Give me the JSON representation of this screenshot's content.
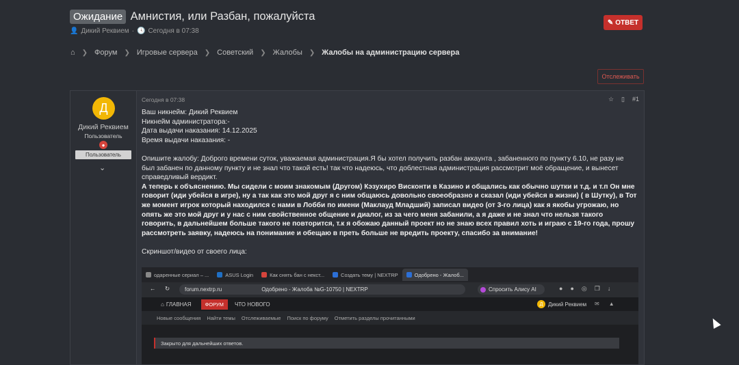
{
  "header": {
    "status": "Ожидание",
    "title": "Амнистия, или Разбан, пожалуйста",
    "author": "Дикий Реквием",
    "date": "Сегодня в 07:38",
    "reply": "ОТВЕТ"
  },
  "breadcrumbs": [
    "Форум",
    "Игровые сервера",
    "Советский",
    "Жалобы",
    "Жалобы на администрацию сервера"
  ],
  "watch": "Отслеживать",
  "post": {
    "user": {
      "avatar_letter": "Д",
      "name": "Дикий Реквием",
      "role": "Пользователь",
      "role_banner": "Пользователь"
    },
    "time": "Сегодня в 07:38",
    "number": "#1",
    "lines": [
      "Ваш никнейм: Дикий Реквием",
      "Никнейм администратора:-",
      "Дата выдачи наказания: 14.12.2025",
      "Время выдачи наказания: -",
      "Опишите жалобу: Доброго времени суток, уважаемая администрация.Я бы хотел получить разбан аккаунта , забаненного по пункту 6.10, не разу не был забанен по данному пункту и не знал что такой есть! так что надеюсь, что доблестная администрация рассмотрит моё обращение, и вынесет справедливый вердикт.",
      "А теперь к объяснению. Мы сидели с моим знакомым (Другом) Кэзухиро Висконти в Казино и общались как обычно шутки и т.д. и т.п Он мне говорит (иди убейся в игре), ну а так как это мой друг я с ним общаюсь довольно своеобразно и сказал (иди убейся в жизни) ( в Шутку), в Тот же момент игрок который находился с нами в Лобби по имени (Маклауд Младший) записал видео (от 3-го лица) как я якобы угрожаю, но опять же это мой друг и у нас с ним свойственное общение и диалог, из за чего меня забанили, а я даже и не знал что нельзя такого говорить, в дальнейшем больше такого не повторится, т.к я обожаю данный проект но не знаю всех правил хоть и играю с 19-го года, прошу рассмотреть заявку, надеюсь на понимание и обещаю в преть больше не вредить проекту, спасибо за внимание!",
      "Скриншот/видео от своего лица:"
    ]
  },
  "screenshot": {
    "tabs": [
      "одаренные сериал – ...",
      "ASUS Login",
      "Как снять бан с некст...",
      "Создать тему | NEXTRP",
      "Одобрено - Жалоб..."
    ],
    "url": "forum.nextrp.ru",
    "page_title": "Одобрено - Жалоба №G-10750 | NEXTRP",
    "alice": "Спросить Алису AI",
    "nav": {
      "home": "ГЛАВНАЯ",
      "forum": "ФОРУМ",
      "whats_new": "ЧТО НОВОГО",
      "user": "Дикий Реквием"
    },
    "subnav": [
      "Новые сообщения",
      "Найти темы",
      "Отслеживаемые",
      "Поиск по форуму",
      "Отметить разделы прочитанными"
    ],
    "closed_notice": "Закрыто для дальнейших ответов."
  }
}
